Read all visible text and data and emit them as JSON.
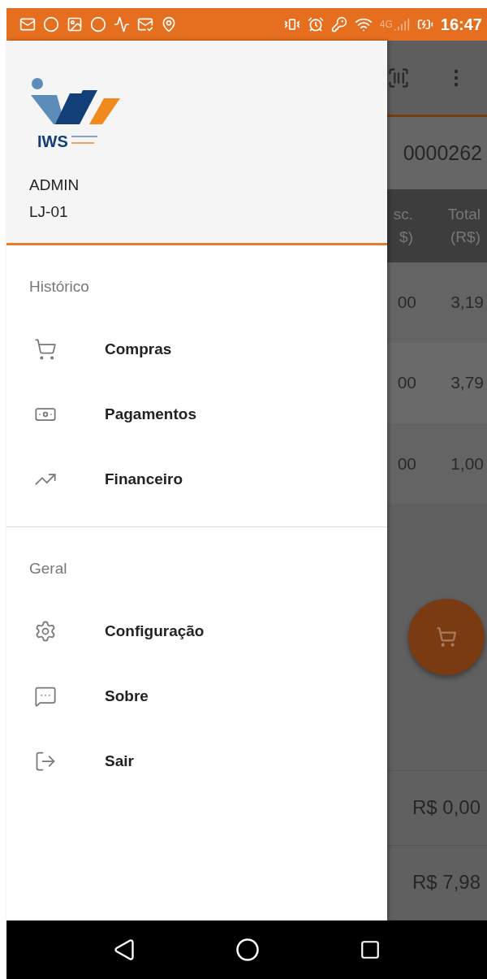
{
  "status_bar": {
    "network": "4G",
    "time": "16:47"
  },
  "drawer": {
    "logo": {
      "text": "IWS"
    },
    "user": "ADMIN",
    "store": "LJ-01",
    "sections": [
      {
        "title": "Histórico",
        "items": [
          {
            "label": "Compras"
          },
          {
            "label": "Pagamentos"
          },
          {
            "label": "Financeiro"
          }
        ]
      },
      {
        "title": "Geral",
        "items": [
          {
            "label": "Configuração"
          },
          {
            "label": "Sobre"
          },
          {
            "label": "Sair"
          }
        ]
      }
    ]
  },
  "background_screen": {
    "order_number": "0000262",
    "columns": [
      {
        "lines": [
          "sc.",
          "$)"
        ]
      },
      {
        "lines": [
          "Total",
          "(R$)"
        ]
      }
    ],
    "rows": [
      [
        "00",
        "3,19"
      ],
      [
        "00",
        "3,79"
      ],
      [
        "00",
        "1,00"
      ]
    ],
    "totals": [
      "R$ 0,00",
      "R$ 7,98"
    ]
  }
}
